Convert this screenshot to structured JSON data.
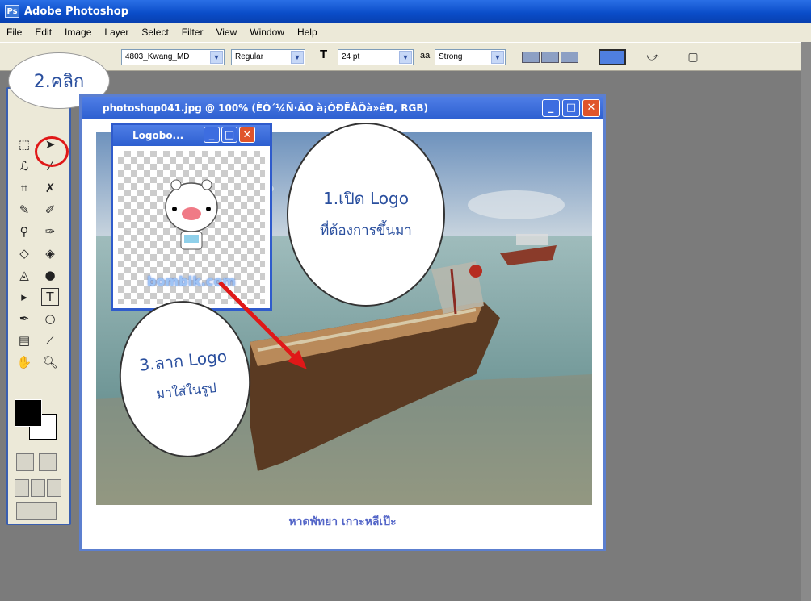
{
  "app": {
    "title": "Adobe Photoshop"
  },
  "menu": [
    "File",
    "Edit",
    "Image",
    "Layer",
    "Select",
    "Filter",
    "View",
    "Window",
    "Help"
  ],
  "options": {
    "font_family": "4803_Kwang_MD",
    "font_style": "Regular",
    "font_size": "24 pt",
    "anti_alias": "Strong",
    "text_color": "#4f7fe0"
  },
  "callout_click": "2.คลิก",
  "document": {
    "title": "photoshop041.jpg @ 100% (ÈÓ´¼Ñ·ÂÒ à¡ÒÐËÅÕà»êÐ, RGB)",
    "caption": "หาดพัทยา เกาะหลีเป๊ะ"
  },
  "logo_window": {
    "title": "Logobo...",
    "logo_text": "bombik.com"
  },
  "callout_open": {
    "line1": "1.เปิด Logo",
    "line2": "ที่ต้องการขึ้นมา"
  },
  "callout_drag": {
    "line1": "3.ลาก Logo",
    "line2": "มาใส่ในรูป"
  },
  "colors": {
    "accent": "#2a4f9e",
    "highlight": "#e01818",
    "arrow": "#e01818"
  }
}
